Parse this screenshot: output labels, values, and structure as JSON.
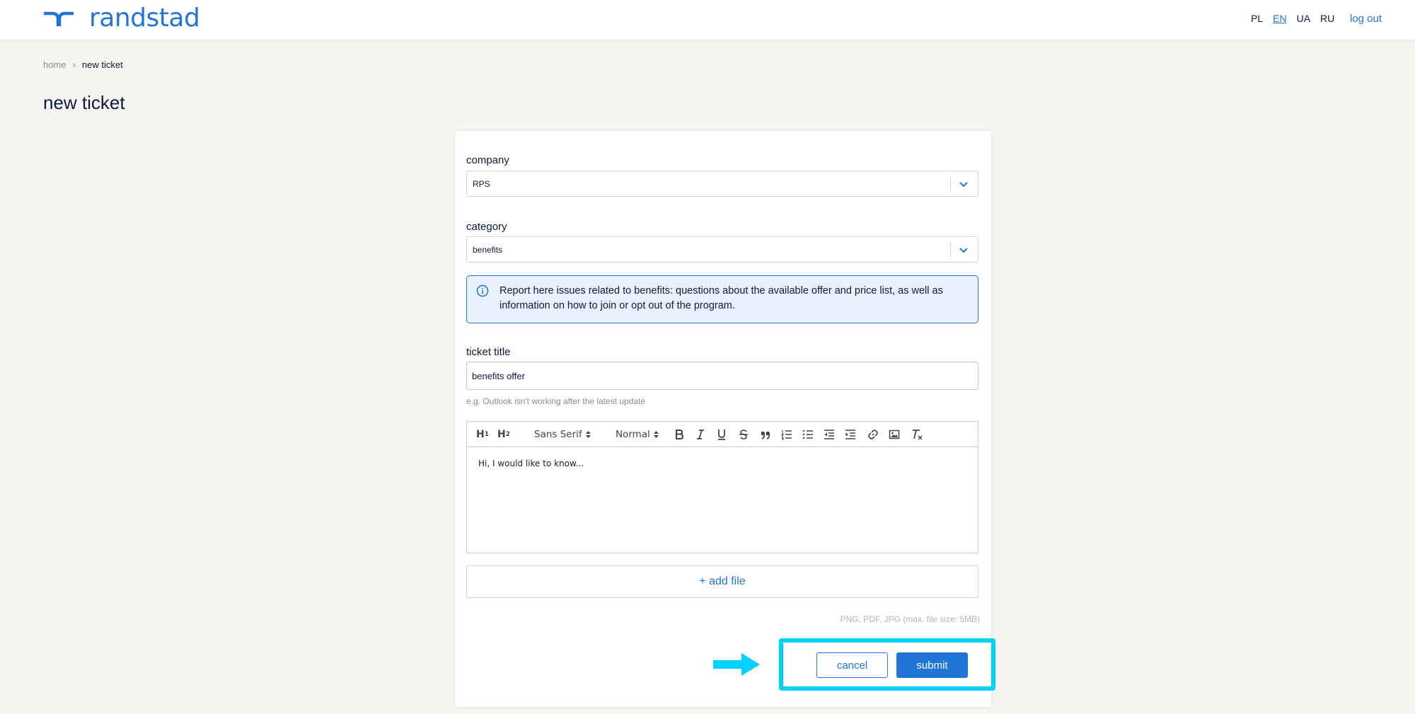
{
  "header": {
    "logo_text": "randstad",
    "languages": [
      {
        "code": "PL",
        "active": false
      },
      {
        "code": "EN",
        "active": true
      },
      {
        "code": "UA",
        "active": false
      },
      {
        "code": "RU",
        "active": false
      }
    ],
    "logout_label": "log out"
  },
  "breadcrumb": {
    "home": "home",
    "separator": "›",
    "current": "new ticket"
  },
  "page": {
    "title": "new ticket"
  },
  "form": {
    "company": {
      "label": "company",
      "value": "RPS"
    },
    "category": {
      "label": "category",
      "value": "benefits"
    },
    "info_text": "Report here issues related to benefits: questions about the available offer and price list, as well as information on how to join or opt out of the program.",
    "ticket_title": {
      "label": "ticket title",
      "value": "benefits offer",
      "hint": "e.g. Outlook isn't working after the latest update"
    },
    "editor": {
      "h1": "H",
      "h2": "H",
      "h1_sub": "1",
      "h2_sub": "2",
      "font": "Sans Serif",
      "size": "Normal",
      "content": "Hi, I would like to know..."
    },
    "add_file_label": "+ add file",
    "file_hint": "PNG, PDF, JPG (max. file size: 5MB)",
    "cancel_label": "cancel",
    "submit_label": "submit"
  },
  "colors": {
    "brand": "#2175d9",
    "page_bg": "#f5f4f0",
    "info_bg": "#e8f1fc",
    "annotation": "#00d2ff"
  },
  "icons": [
    "randstad-logo-icon",
    "chevron-down-icon",
    "info-icon",
    "bold-icon",
    "italic-icon",
    "underline-icon",
    "strike-icon",
    "blockquote-icon",
    "ordered-list-icon",
    "bullet-list-icon",
    "outdent-icon",
    "indent-icon",
    "link-icon",
    "image-icon",
    "clear-format-icon",
    "arrow-right-icon"
  ]
}
